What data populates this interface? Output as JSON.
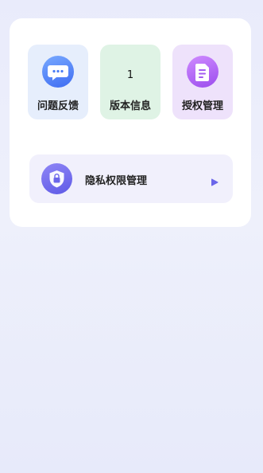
{
  "grid": {
    "feedback": {
      "label": "问题反馈",
      "icon": "chat-bubble-icon"
    },
    "version": {
      "label": "版本信息",
      "value": "1"
    },
    "authorization": {
      "label": "授权管理",
      "icon": "document-icon"
    }
  },
  "privacy": {
    "label": "隐私权限管理",
    "icon": "shield-lock-icon",
    "arrow": "play-arrow-icon"
  },
  "colors": {
    "accent_blue": "#4a7cf5",
    "accent_purple": "#a35cf0",
    "accent_indigo": "#6b66ea"
  }
}
